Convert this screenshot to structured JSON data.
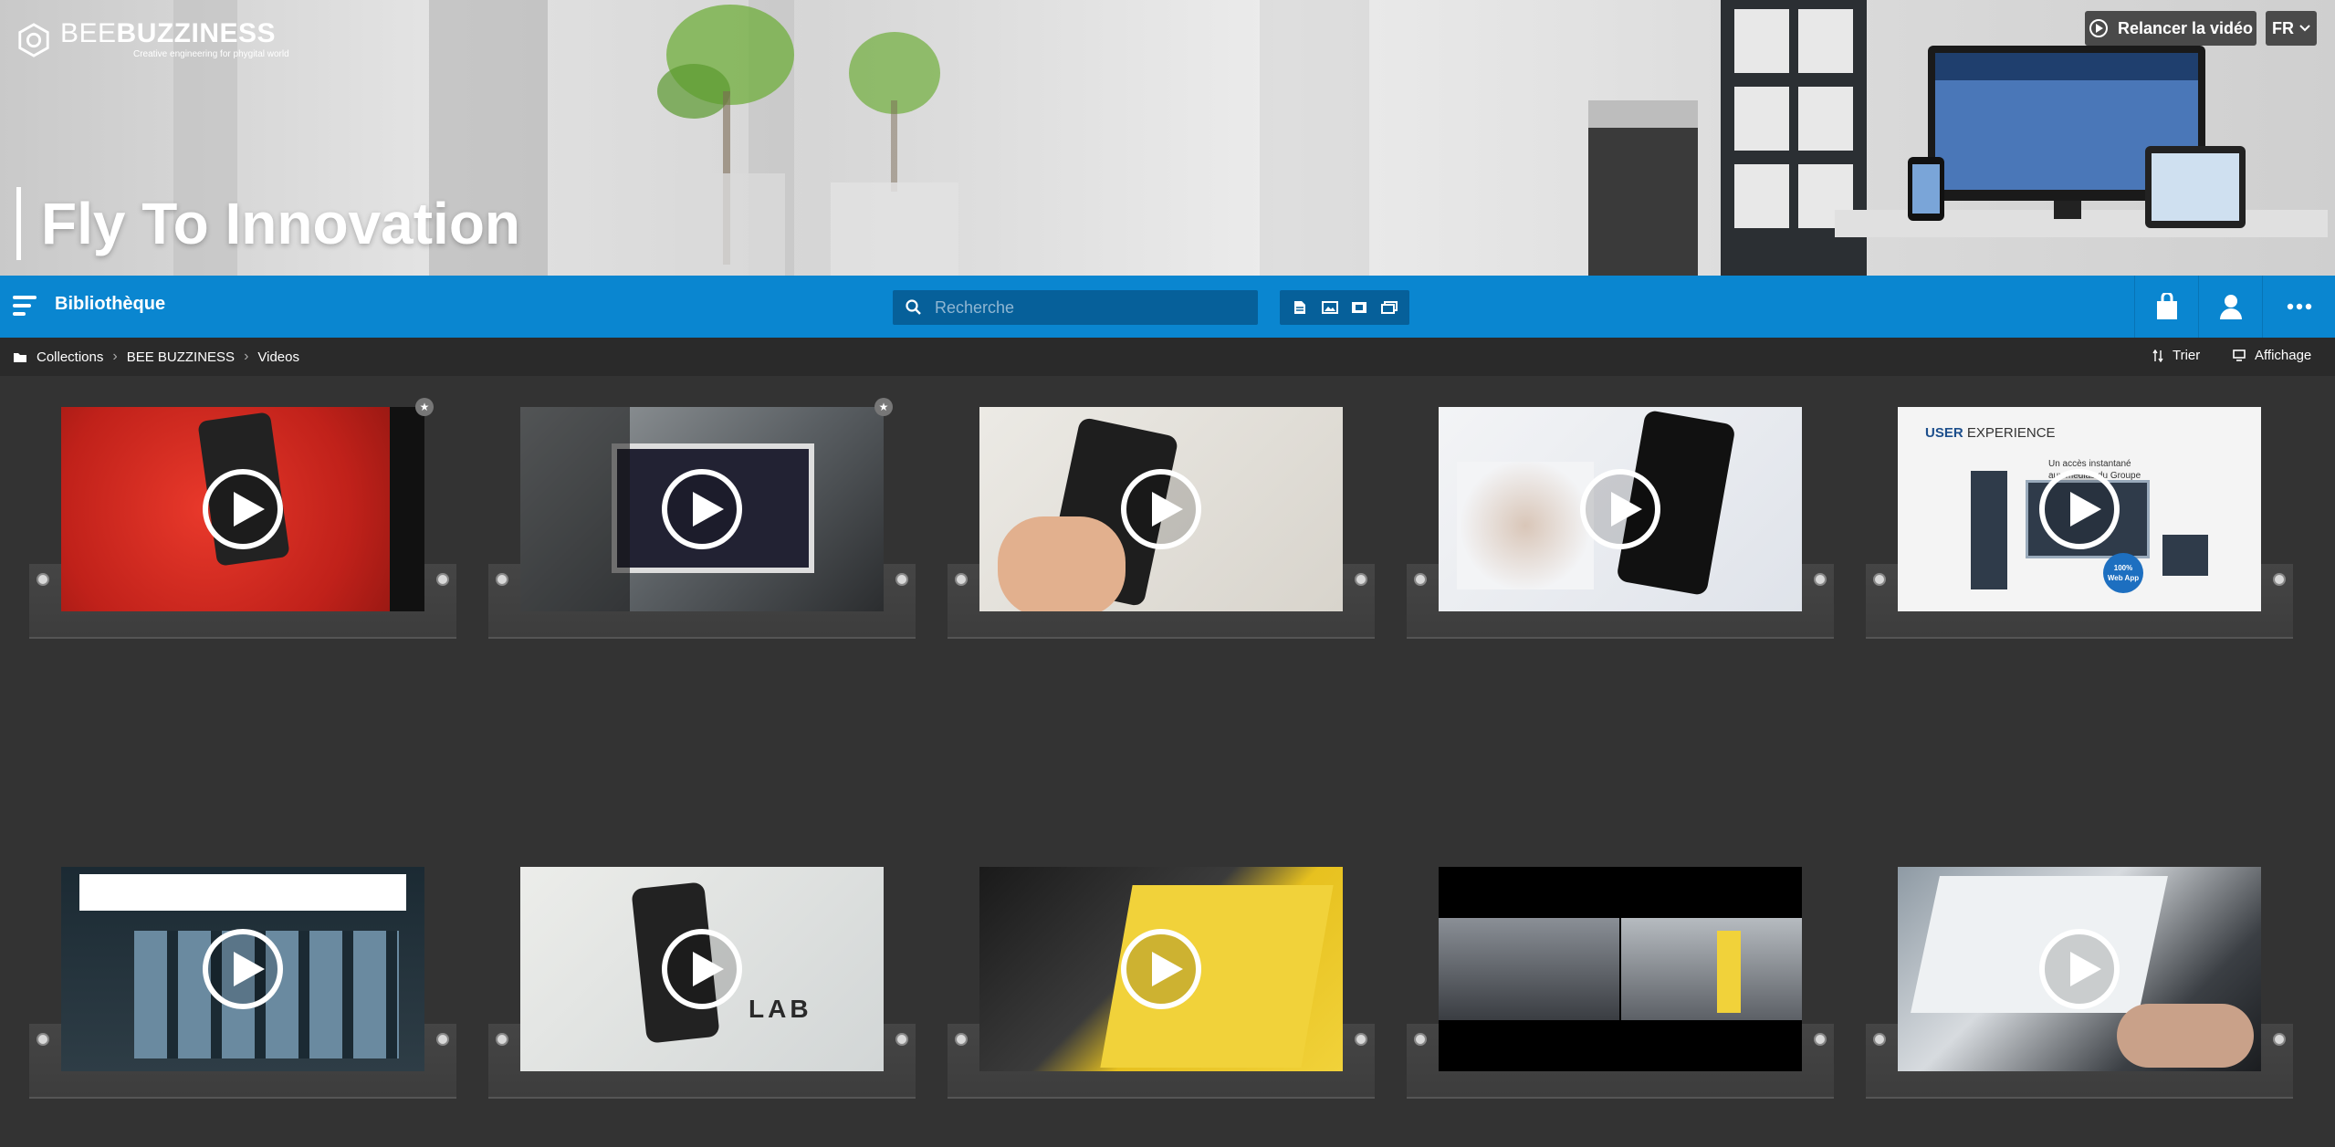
{
  "brand": {
    "name_part1": "BEE",
    "name_part2": "BUZZINESS",
    "tagline": "Creative engineering for phygital world"
  },
  "hero": {
    "title": "Fly To Innovation",
    "replay_label": "Relancer la vidéo",
    "lang_label": "FR"
  },
  "topbar": {
    "title": "Bibliothèque",
    "search_placeholder": "Recherche",
    "type_filters": [
      "document-icon",
      "image-icon",
      "video-icon",
      "presentation-icon"
    ],
    "right_actions": [
      "basket-icon",
      "user-icon",
      "more-icon"
    ],
    "accent_color": "#0a86d0"
  },
  "breadcrumb": {
    "items": [
      "Collections",
      "BEE BUZZINESS",
      "Videos"
    ],
    "sort_label": "Trier",
    "view_label": "Affichage"
  },
  "grid": {
    "items": [
      {
        "id": 1,
        "favorite": true
      },
      {
        "id": 2,
        "favorite": true
      },
      {
        "id": 3,
        "favorite": false
      },
      {
        "id": 4,
        "favorite": false
      },
      {
        "id": 5,
        "favorite": false,
        "title": "USER EXPERIENCE",
        "title_bold": "USER",
        "title_light": "EXPERIENCE",
        "subtitle_line1": "Un accès instantané",
        "subtitle_line2": "aux médias du Groupe",
        "badge_line1": "100%",
        "badge_line2": "Web App"
      },
      {
        "id": 6,
        "favorite": false
      },
      {
        "id": 7,
        "favorite": false,
        "overlay_text": "LAB"
      },
      {
        "id": 8,
        "favorite": false
      },
      {
        "id": 9,
        "favorite": false
      },
      {
        "id": 10,
        "favorite": false
      }
    ]
  }
}
